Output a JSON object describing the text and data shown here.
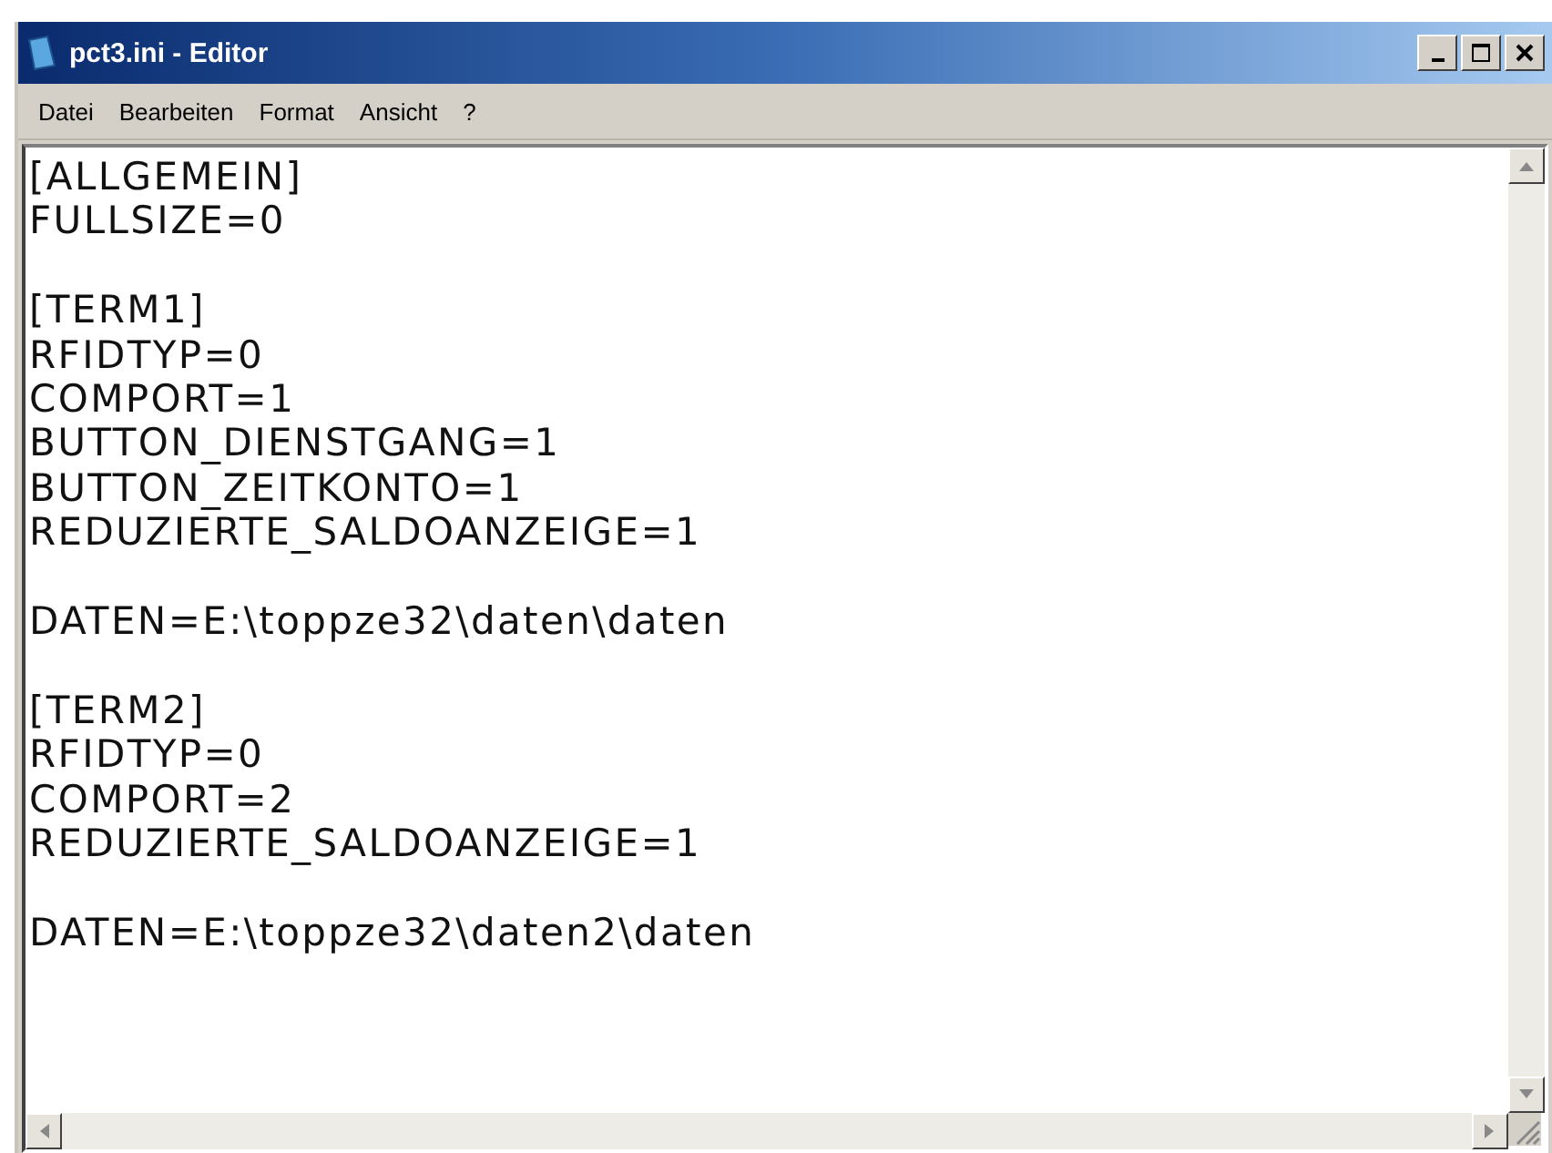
{
  "window": {
    "title": "pct3.ini - Editor"
  },
  "menu": [
    "Datei",
    "Bearbeiten",
    "Format",
    "Ansicht",
    "?"
  ],
  "editor": {
    "blocks": [
      [
        "[ALLGEMEIN]",
        "FULLSIZE=0"
      ],
      [
        "[TERM1]",
        "RFIDTYP=0",
        "COMPORT=1",
        "BUTTON_DIENSTGANG=1",
        "BUTTON_ZEITKONTO=1",
        "REDUZIERTE_SALDOANZEIGE=1"
      ],
      [
        "DATEN=E:\\toppze32\\daten\\daten"
      ],
      [
        "[TERM2]",
        "RFIDTYP=0",
        "COMPORT=2",
        "REDUZIERTE_SALDOANZEIGE=1"
      ],
      [
        "DATEN=E:\\toppze32\\daten2\\daten"
      ]
    ]
  }
}
